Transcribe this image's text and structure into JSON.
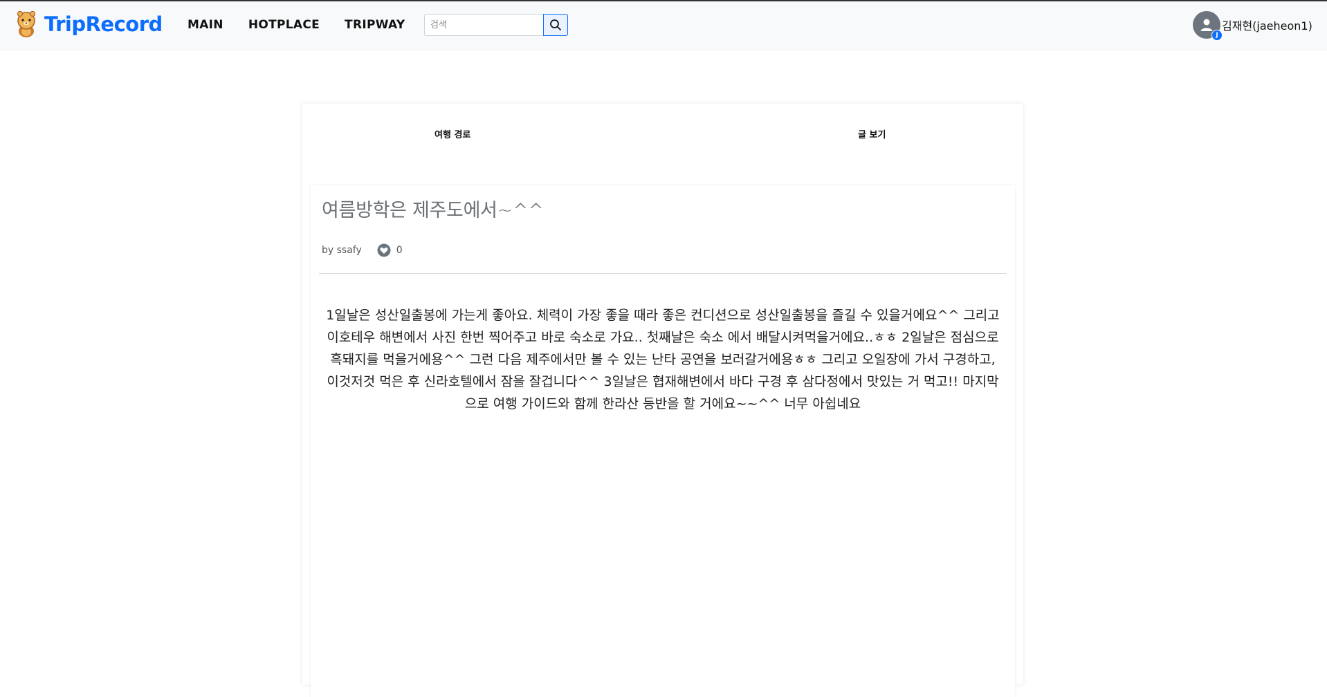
{
  "navbar": {
    "brand": "TripRecord",
    "links": [
      "MAIN",
      "HOTPLACE",
      "TRIPWAY"
    ],
    "search_placeholder": "검색",
    "user_initial": "J",
    "username": "김재현(jaeheon1)"
  },
  "tabs": {
    "route": "여행 경로",
    "post": "글 보기"
  },
  "post": {
    "title": "여름방학은 제주도에서~^^",
    "author": "by ssafy",
    "likes": "0",
    "content": "1일날은 성산일출봉에 가는게 좋아요. 체력이 가장 좋을 때라 좋은 컨디션으로 성산일출봉을 즐길 수 있을거에요^^ 그리고 이호테우 해변에서 사진 한번 찍어주고 바로 숙소로 가요.. 첫째날은 숙소 에서 배달시켜먹을거에요..ㅎㅎ 2일날은 점심으로 흑돼지를 먹을거에용^^ 그런 다음 제주에서만 볼 수 있는 난타 공연을 보러갈거에용ㅎㅎ 그리고 오일장에 가서 구경하고, 이것저것 먹은 후 신라호텔에서 잠을 잘겁니다^^ 3일날은 협재해변에서 바다 구경 후 삼다정에서 맛있는 거 먹고!! 마지막으로 여행 가이드와 함께 한라산 등반을 할 거에요~~^^ 너무 아쉽네요"
  },
  "colors": {
    "brand": "#0d6efd",
    "navbar_bg": "#f8f9fa",
    "title": "#6a6f74"
  },
  "icons": [
    "logo-mascot-icon",
    "search-icon",
    "user-avatar-icon",
    "heart-icon"
  ]
}
